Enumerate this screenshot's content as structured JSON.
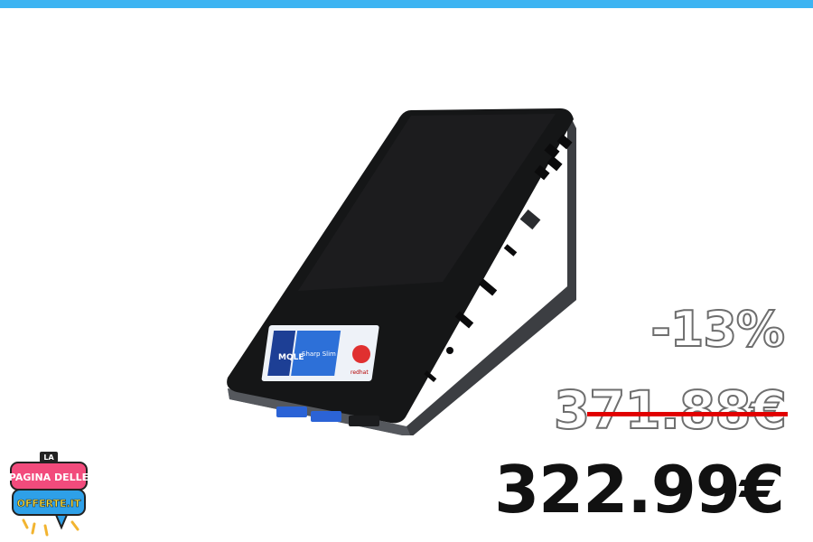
{
  "colors": {
    "top_bar": "#3db4f2",
    "strike": "#e10000",
    "price": "#111111",
    "outline_text": "#6e6e6e"
  },
  "product": {
    "image": "mini-pc-device",
    "label_brand": "MQLE",
    "label_model": "Sharp Slim",
    "label_badge": "redhat"
  },
  "pricing": {
    "discount": "-13%",
    "old_price": "371.88€",
    "new_price": "322.99€"
  },
  "logo": {
    "top": "LA",
    "line1": "PAGINA DELLE",
    "line2": "OFFERTE.IT"
  }
}
